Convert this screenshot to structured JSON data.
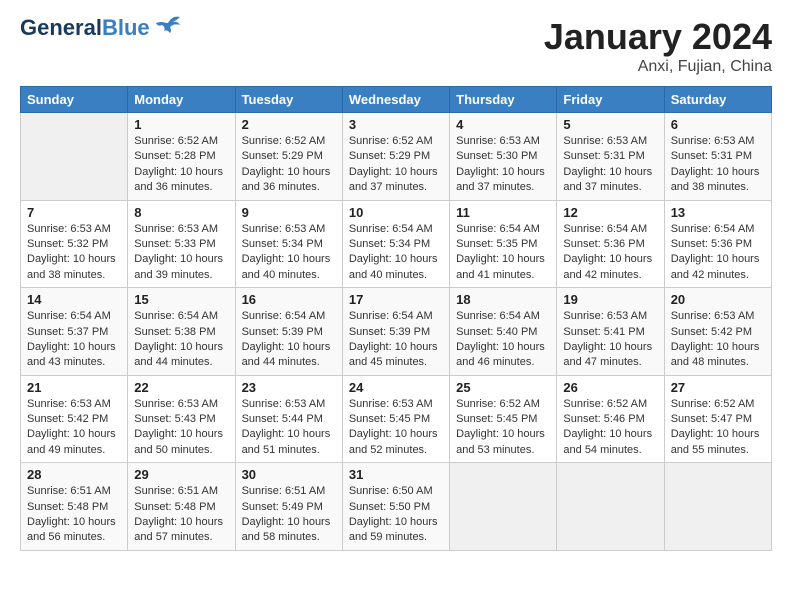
{
  "header": {
    "logo_line1": "General",
    "logo_line2": "Blue",
    "month": "January 2024",
    "location": "Anxi, Fujian, China"
  },
  "days_of_week": [
    "Sunday",
    "Monday",
    "Tuesday",
    "Wednesday",
    "Thursday",
    "Friday",
    "Saturday"
  ],
  "weeks": [
    [
      {
        "day": "",
        "empty": true
      },
      {
        "day": "1",
        "sunrise": "6:52 AM",
        "sunset": "5:28 PM",
        "daylight": "10 hours and 36 minutes."
      },
      {
        "day": "2",
        "sunrise": "6:52 AM",
        "sunset": "5:29 PM",
        "daylight": "10 hours and 36 minutes."
      },
      {
        "day": "3",
        "sunrise": "6:52 AM",
        "sunset": "5:29 PM",
        "daylight": "10 hours and 37 minutes."
      },
      {
        "day": "4",
        "sunrise": "6:53 AM",
        "sunset": "5:30 PM",
        "daylight": "10 hours and 37 minutes."
      },
      {
        "day": "5",
        "sunrise": "6:53 AM",
        "sunset": "5:31 PM",
        "daylight": "10 hours and 37 minutes."
      },
      {
        "day": "6",
        "sunrise": "6:53 AM",
        "sunset": "5:31 PM",
        "daylight": "10 hours and 38 minutes."
      }
    ],
    [
      {
        "day": "7",
        "sunrise": "6:53 AM",
        "sunset": "5:32 PM",
        "daylight": "10 hours and 38 minutes."
      },
      {
        "day": "8",
        "sunrise": "6:53 AM",
        "sunset": "5:33 PM",
        "daylight": "10 hours and 39 minutes."
      },
      {
        "day": "9",
        "sunrise": "6:53 AM",
        "sunset": "5:34 PM",
        "daylight": "10 hours and 40 minutes."
      },
      {
        "day": "10",
        "sunrise": "6:54 AM",
        "sunset": "5:34 PM",
        "daylight": "10 hours and 40 minutes."
      },
      {
        "day": "11",
        "sunrise": "6:54 AM",
        "sunset": "5:35 PM",
        "daylight": "10 hours and 41 minutes."
      },
      {
        "day": "12",
        "sunrise": "6:54 AM",
        "sunset": "5:36 PM",
        "daylight": "10 hours and 42 minutes."
      },
      {
        "day": "13",
        "sunrise": "6:54 AM",
        "sunset": "5:36 PM",
        "daylight": "10 hours and 42 minutes."
      }
    ],
    [
      {
        "day": "14",
        "sunrise": "6:54 AM",
        "sunset": "5:37 PM",
        "daylight": "10 hours and 43 minutes."
      },
      {
        "day": "15",
        "sunrise": "6:54 AM",
        "sunset": "5:38 PM",
        "daylight": "10 hours and 44 minutes."
      },
      {
        "day": "16",
        "sunrise": "6:54 AM",
        "sunset": "5:39 PM",
        "daylight": "10 hours and 44 minutes."
      },
      {
        "day": "17",
        "sunrise": "6:54 AM",
        "sunset": "5:39 PM",
        "daylight": "10 hours and 45 minutes."
      },
      {
        "day": "18",
        "sunrise": "6:54 AM",
        "sunset": "5:40 PM",
        "daylight": "10 hours and 46 minutes."
      },
      {
        "day": "19",
        "sunrise": "6:53 AM",
        "sunset": "5:41 PM",
        "daylight": "10 hours and 47 minutes."
      },
      {
        "day": "20",
        "sunrise": "6:53 AM",
        "sunset": "5:42 PM",
        "daylight": "10 hours and 48 minutes."
      }
    ],
    [
      {
        "day": "21",
        "sunrise": "6:53 AM",
        "sunset": "5:42 PM",
        "daylight": "10 hours and 49 minutes."
      },
      {
        "day": "22",
        "sunrise": "6:53 AM",
        "sunset": "5:43 PM",
        "daylight": "10 hours and 50 minutes."
      },
      {
        "day": "23",
        "sunrise": "6:53 AM",
        "sunset": "5:44 PM",
        "daylight": "10 hours and 51 minutes."
      },
      {
        "day": "24",
        "sunrise": "6:53 AM",
        "sunset": "5:45 PM",
        "daylight": "10 hours and 52 minutes."
      },
      {
        "day": "25",
        "sunrise": "6:52 AM",
        "sunset": "5:45 PM",
        "daylight": "10 hours and 53 minutes."
      },
      {
        "day": "26",
        "sunrise": "6:52 AM",
        "sunset": "5:46 PM",
        "daylight": "10 hours and 54 minutes."
      },
      {
        "day": "27",
        "sunrise": "6:52 AM",
        "sunset": "5:47 PM",
        "daylight": "10 hours and 55 minutes."
      }
    ],
    [
      {
        "day": "28",
        "sunrise": "6:51 AM",
        "sunset": "5:48 PM",
        "daylight": "10 hours and 56 minutes."
      },
      {
        "day": "29",
        "sunrise": "6:51 AM",
        "sunset": "5:48 PM",
        "daylight": "10 hours and 57 minutes."
      },
      {
        "day": "30",
        "sunrise": "6:51 AM",
        "sunset": "5:49 PM",
        "daylight": "10 hours and 58 minutes."
      },
      {
        "day": "31",
        "sunrise": "6:50 AM",
        "sunset": "5:50 PM",
        "daylight": "10 hours and 59 minutes."
      },
      {
        "day": "",
        "empty": true
      },
      {
        "day": "",
        "empty": true
      },
      {
        "day": "",
        "empty": true
      }
    ]
  ]
}
